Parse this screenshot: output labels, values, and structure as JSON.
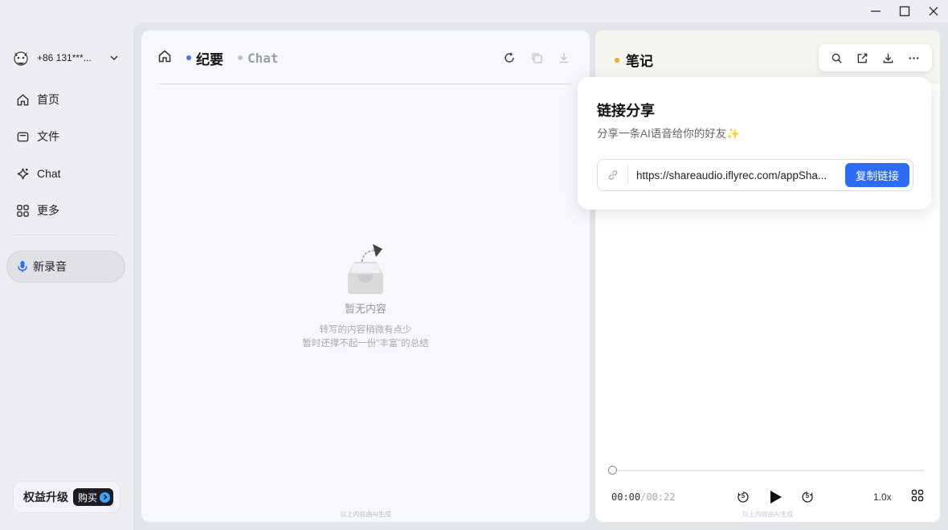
{
  "window_controls": {
    "minimize_icon": "minimize-icon",
    "maximize_icon": "maximize-icon",
    "close_icon": "close-icon"
  },
  "sidebar": {
    "account": "+86 131***...",
    "nav": [
      {
        "label": "首页",
        "icon": "home-icon"
      },
      {
        "label": "文件",
        "icon": "folder-icon"
      },
      {
        "label": "Chat",
        "icon": "sparkle-icon"
      },
      {
        "label": "更多",
        "icon": "apps-icon"
      }
    ],
    "new_recording": "新录音",
    "upgrade_label": "权益升级",
    "buy_label": "购买"
  },
  "left_panel": {
    "tabs": [
      {
        "label": "纪要",
        "active": true
      },
      {
        "label": "Chat",
        "active": false
      }
    ],
    "empty_title": "暂无内容",
    "empty_desc_1": "转写的内容稍微有点少",
    "empty_desc_2": "暂时还撑不起一份“丰富”的总结",
    "ai_note": "以上内容由AI生成"
  },
  "right_panel": {
    "title": "笔记",
    "time_current": "00:00",
    "time_total": "/00:22",
    "skip_back": "5",
    "skip_forward": "5",
    "speed": "1.0x",
    "progress": 0,
    "ai_note": "以上内容由AI生成"
  },
  "share_popover": {
    "title": "链接分享",
    "subtitle": "分享一条AI语音给你的好友",
    "sparkle": "✨",
    "url": "https://shareaudio.iflyrec.com/appSha...",
    "copy_label": "复制链接"
  },
  "colors": {
    "accent": "#2c6cf6",
    "tab_dot": "#3a7bff",
    "notes_dot": "#f5a623"
  }
}
